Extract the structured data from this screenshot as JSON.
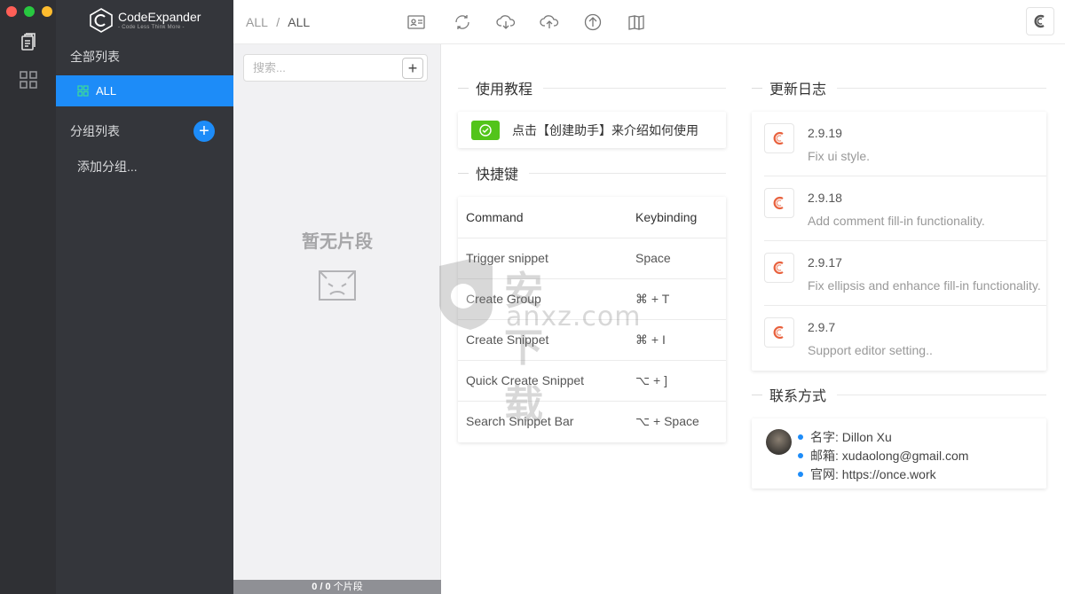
{
  "window": {
    "traffic_lights": [
      "#ff5f57",
      "#28c840",
      "#febc2e"
    ]
  },
  "rail": {
    "icons": [
      "clipboard-icon",
      "grid-icon"
    ]
  },
  "brand": {
    "name": "CodeExpander",
    "tagline": "- Code Less Think More -"
  },
  "groups": {
    "all_list_title": "全部列表",
    "all_item_label": "ALL",
    "group_list_title": "分组列表",
    "add_group_label": "添加分组..."
  },
  "toolbar": {
    "breadcrumb_root": "ALL",
    "breadcrumb_sep": "/",
    "breadcrumb_current": "ALL",
    "icons": [
      "id-card-icon",
      "sync-icon",
      "cloud-download-icon",
      "cloud-upload-icon",
      "arrow-up-circle-icon",
      "book-icon"
    ]
  },
  "snippets": {
    "search_placeholder": "搜索...",
    "add_symbol": "+",
    "empty_text": "暂无片段",
    "footer_count": "0 / 0",
    "footer_suffix": " 个片段"
  },
  "tutorial": {
    "title": "使用教程",
    "text": "点击【创建助手】来介绍如何使用"
  },
  "shortcuts": {
    "title": "快捷键",
    "headers": [
      "Command",
      "Keybinding"
    ],
    "rows": [
      {
        "command": "Trigger snippet",
        "key": "Space"
      },
      {
        "command": "Create Group",
        "key": "⌘ + T"
      },
      {
        "command": "Create Snippet",
        "key": "⌘ + I"
      },
      {
        "command": "Quick Create Snippet",
        "key": "⌥ + ]"
      },
      {
        "command": "Search Snippet Bar",
        "key": "⌥ + Space"
      }
    ]
  },
  "changelog": {
    "title": "更新日志",
    "items": [
      {
        "version": "2.9.19",
        "desc": "Fix ui style."
      },
      {
        "version": "2.9.18",
        "desc": "Add comment fill-in functionality."
      },
      {
        "version": "2.9.17",
        "desc": "Fix ellipsis and enhance fill-in functionality."
      },
      {
        "version": "2.9.7",
        "desc": "Support editor setting.."
      }
    ]
  },
  "contact": {
    "title": "联系方式",
    "name": "名字: Dillon Xu",
    "email": "邮箱: xudaolong@gmail.com",
    "site": "官网: https://once.work"
  },
  "watermark": {
    "cn": "安下载",
    "domain": "anxz.com"
  },
  "colors": {
    "accent": "#1d8cf8",
    "success": "#52c41a",
    "brand_logo": "#e8603c"
  }
}
